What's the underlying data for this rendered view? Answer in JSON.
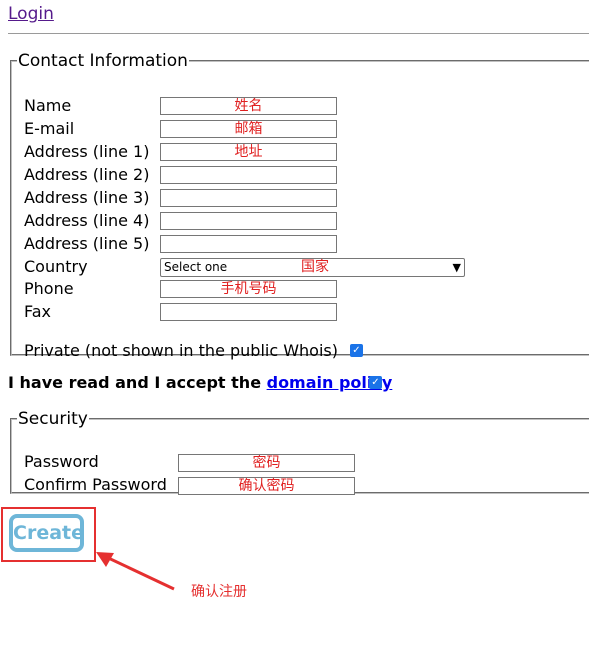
{
  "header": {
    "login_label": "Login"
  },
  "contact": {
    "legend": "Contact Information",
    "fields": [
      {
        "label": "Name",
        "value": "姓名"
      },
      {
        "label": "E-mail",
        "value": "邮箱"
      },
      {
        "label": "Address (line 1)",
        "value": "地址"
      },
      {
        "label": "Address (line 2)",
        "value": ""
      },
      {
        "label": "Address (line 3)",
        "value": ""
      },
      {
        "label": "Address (line 4)",
        "value": ""
      },
      {
        "label": "Address (line 5)",
        "value": ""
      }
    ],
    "country": {
      "label": "Country",
      "selected": "Select one",
      "annotation": "国家"
    },
    "phone": {
      "label": "Phone",
      "value": "手机号码"
    },
    "fax": {
      "label": "Fax",
      "value": ""
    },
    "private": {
      "label": "Private (not shown in the public Whois)",
      "checked": true
    }
  },
  "policy": {
    "prefix": "I have read and I accept the ",
    "link": "domain policy",
    "checked": true
  },
  "security": {
    "legend": "Security",
    "password": {
      "label": "Password",
      "value": "密码"
    },
    "confirm": {
      "label": "Confirm Password",
      "value": "确认密码"
    }
  },
  "create_button": {
    "label": "Create"
  },
  "annotation": {
    "text": "确认注册",
    "color": "#e53030"
  },
  "colors": {
    "accent": "#1a73e8",
    "button": "#6eb6d8",
    "link": "#0000ee",
    "visited": "#551a8b"
  }
}
